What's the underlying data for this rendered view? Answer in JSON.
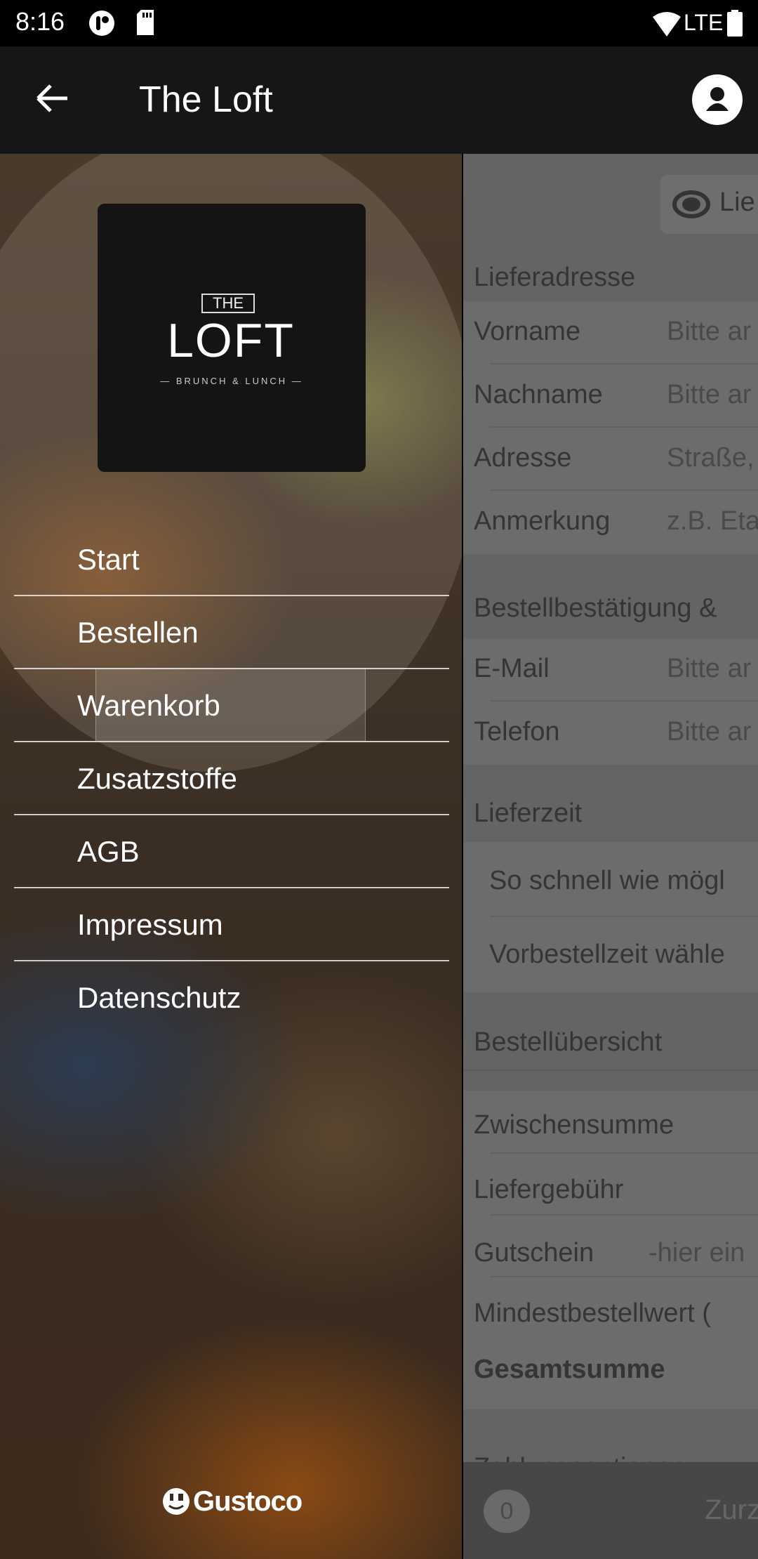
{
  "status_bar": {
    "time": "8:16",
    "network": "LTE"
  },
  "app_bar": {
    "title": "The Loft"
  },
  "drawer": {
    "logo": {
      "top": "THE",
      "name": "LOFT",
      "tagline": "BRUNCH & LUNCH"
    },
    "items": [
      {
        "label": "Start"
      },
      {
        "label": "Bestellen"
      },
      {
        "label": "Warenkorb"
      },
      {
        "label": "Zusatzstoffe"
      },
      {
        "label": "AGB"
      },
      {
        "label": "Impressum"
      },
      {
        "label": "Datenschutz"
      }
    ],
    "footer_brand": "Gustoco"
  },
  "checkout": {
    "delivery_option": "Lie",
    "address": {
      "header": "Lieferadresse",
      "fields": [
        {
          "label": "Vorname",
          "placeholder": "Bitte ar"
        },
        {
          "label": "Nachname",
          "placeholder": "Bitte ar"
        },
        {
          "label": "Adresse",
          "placeholder": "Straße,"
        },
        {
          "label": "Anmerkung",
          "placeholder": "z.B. Eta"
        }
      ]
    },
    "contact": {
      "header": "Bestellbestätigung &",
      "fields": [
        {
          "label": "E-Mail",
          "placeholder": "Bitte ar"
        },
        {
          "label": "Telefon",
          "placeholder": "Bitte ar"
        }
      ]
    },
    "delivery_time": {
      "header": "Lieferzeit",
      "options": [
        "So schnell wie mögl",
        "Vorbestellzeit wähle"
      ]
    },
    "summary": {
      "header": "Bestellübersicht",
      "subtotal": "Zwischensumme",
      "fee": "Liefergebühr",
      "voucher": "Gutschein",
      "voucher_placeholder": "-hier ein",
      "minimum": "Mindestbestellwert (",
      "total": "Gesamtsumme"
    },
    "payment_header": "Zahlungsoptionen",
    "bottom": {
      "count": "0",
      "button": "Zurz"
    }
  }
}
